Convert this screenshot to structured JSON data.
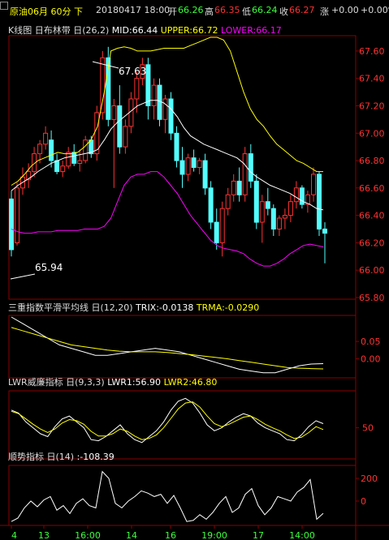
{
  "window": {
    "title": "原油06月 60分 下"
  },
  "quote": {
    "date_time": "20180417 18:00",
    "open_label": "开",
    "open": "66.26",
    "high_label": "高",
    "high": "66.35",
    "low_label": "低",
    "low": "66.24",
    "close_label": "收",
    "close": "66.27",
    "change_label": "涨",
    "change": "+0.00",
    "change_pct": "+0.00%"
  },
  "kline_panel": {
    "name": "K线图",
    "toggle": "日",
    "indicator": "布林带",
    "params": "(26,2)",
    "mid_label": "MID:66.44",
    "upper_label": "UPPER:66.72",
    "lower_label": "LOWER:66.17",
    "high_marker": "67.63",
    "low_marker": "65.94",
    "y_ticks": [
      "67.60",
      "67.40",
      "67.20",
      "67.00",
      "66.80",
      "66.60",
      "66.40",
      "66.20",
      "66.00",
      "65.80"
    ]
  },
  "trix_panel": {
    "name": "三重指数平滑平均线",
    "toggle": "日",
    "params": "(12,20)",
    "trix_label": "TRIX:-0.0138",
    "trma_label": "TRMA:-0.0290",
    "y_ticks": [
      "0.05",
      "0.00"
    ]
  },
  "lwr_panel": {
    "name": "LWR威廉指标",
    "toggle": "日",
    "params": "(9,3,3)",
    "lwr1_label": "LWR1:56.90",
    "lwr2_label": "LWR2:46.80",
    "y_ticks": [
      "50"
    ]
  },
  "cci_panel": {
    "name": "顺势指标",
    "toggle": "日",
    "params": "(14)",
    "value_label": ":-108.39",
    "y_ticks": [
      "200",
      "0"
    ]
  },
  "x_axis": {
    "labels": [
      "4",
      "13",
      "16:00",
      "14",
      "16",
      "19:00",
      "17",
      "14:00"
    ]
  },
  "colors": {
    "up": "#ff3232",
    "down": "#54ffff",
    "upper": "#ffff00",
    "mid": "#ffffff",
    "lower": "#ff00ff",
    "grid": "#8b0000",
    "axis_text": "#ff3232"
  },
  "chart_data": [
    {
      "type": "candlestick",
      "title": "原油06月 60分",
      "series": [
        {
          "name": "K",
          "values": [
            [
              66.52,
              66.58,
              66.1,
              66.15
            ],
            [
              66.2,
              66.64,
              66.18,
              66.6
            ],
            [
              66.6,
              66.75,
              66.55,
              66.68
            ],
            [
              66.66,
              66.78,
              66.6,
              66.72
            ],
            [
              66.72,
              66.9,
              66.68,
              66.85
            ],
            [
              66.85,
              66.95,
              66.78,
              66.92
            ],
            [
              66.92,
              67.05,
              66.88,
              67.0
            ],
            [
              66.95,
              67.02,
              66.75,
              66.8
            ],
            [
              66.8,
              66.85,
              66.7,
              66.72
            ],
            [
              66.72,
              66.8,
              66.68,
              66.76
            ],
            [
              66.76,
              66.9,
              66.74,
              66.86
            ],
            [
              66.86,
              66.92,
              66.76,
              66.78
            ],
            [
              66.78,
              66.88,
              66.72,
              66.8
            ],
            [
              66.8,
              66.98,
              66.78,
              66.95
            ],
            [
              66.95,
              66.98,
              66.82,
              66.85
            ],
            [
              66.85,
              67.2,
              66.8,
              67.15
            ],
            [
              67.15,
              67.6,
              67.1,
              67.55
            ],
            [
              67.55,
              67.63,
              67.05,
              67.1
            ],
            [
              67.1,
              67.25,
              66.6,
              67.2
            ],
            [
              67.2,
              67.35,
              66.85,
              66.9
            ],
            [
              66.9,
              67.1,
              66.85,
              67.05
            ],
            [
              67.05,
              67.3,
              67.0,
              67.25
            ],
            [
              67.25,
              67.45,
              67.15,
              67.4
            ],
            [
              67.4,
              67.55,
              67.35,
              67.5
            ],
            [
              67.5,
              67.55,
              67.1,
              67.2
            ],
            [
              67.2,
              67.4,
              67.1,
              67.35
            ],
            [
              67.35,
              67.4,
              67.05,
              67.1
            ],
            [
              67.1,
              67.28,
              67.0,
              67.25
            ],
            [
              67.25,
              67.3,
              66.95,
              67.0
            ],
            [
              67.0,
              67.05,
              66.75,
              66.8
            ],
            [
              66.8,
              66.9,
              66.6,
              66.7
            ],
            [
              66.7,
              66.85,
              66.65,
              66.82
            ],
            [
              66.82,
              66.88,
              66.72,
              66.75
            ],
            [
              66.75,
              66.82,
              66.7,
              66.8
            ],
            [
              66.8,
              66.85,
              66.55,
              66.6
            ],
            [
              66.6,
              66.65,
              66.3,
              66.35
            ],
            [
              66.35,
              66.45,
              66.15,
              66.2
            ],
            [
              66.2,
              66.5,
              66.1,
              66.45
            ],
            [
              66.45,
              66.6,
              66.4,
              66.55
            ],
            [
              66.55,
              66.7,
              66.5,
              66.65
            ],
            [
              66.65,
              66.75,
              66.5,
              66.55
            ],
            [
              66.55,
              66.9,
              66.5,
              66.85
            ],
            [
              66.85,
              66.92,
              66.6,
              66.65
            ],
            [
              66.65,
              66.7,
              66.3,
              66.35
            ],
            [
              66.35,
              66.55,
              66.2,
              66.5
            ],
            [
              66.5,
              66.6,
              66.4,
              66.45
            ],
            [
              66.45,
              66.48,
              66.25,
              66.3
            ],
            [
              66.3,
              66.4,
              66.25,
              66.38
            ],
            [
              66.38,
              66.45,
              66.3,
              66.4
            ],
            [
              66.4,
              66.55,
              66.35,
              66.5
            ],
            [
              66.5,
              66.65,
              66.45,
              66.6
            ],
            [
              66.6,
              66.62,
              66.45,
              66.48
            ],
            [
              66.48,
              66.58,
              66.42,
              66.55
            ],
            [
              66.55,
              66.75,
              66.5,
              66.7
            ],
            [
              66.7,
              66.72,
              66.25,
              66.3
            ],
            [
              66.3,
              66.35,
              66.05,
              66.27
            ]
          ]
        },
        {
          "name": "UPPER",
          "values": [
            66.62,
            66.65,
            66.7,
            66.76,
            66.8,
            66.82,
            66.84,
            66.86,
            66.85,
            66.85,
            66.86,
            66.9,
            66.95,
            67.05,
            67.3,
            67.6,
            67.62,
            67.63,
            67.62,
            67.6,
            67.6,
            67.6,
            67.61,
            67.62,
            67.62,
            67.62,
            67.62,
            67.64,
            67.66,
            67.68,
            67.7,
            67.7,
            67.68,
            67.6,
            67.45,
            67.3,
            67.18,
            67.1,
            67.05,
            66.98,
            66.92,
            66.88,
            66.84,
            66.8,
            66.78,
            66.75,
            66.72,
            66.72
          ]
        },
        {
          "name": "MID",
          "values": [
            66.58,
            66.62,
            66.65,
            66.68,
            66.72,
            66.75,
            66.78,
            66.8,
            66.82,
            66.83,
            66.84,
            66.85,
            66.86,
            66.88,
            66.95,
            67.03,
            67.08,
            67.12,
            67.16,
            67.2,
            67.22,
            67.24,
            67.24,
            67.22,
            67.18,
            67.12,
            67.04,
            66.98,
            66.95,
            66.92,
            66.9,
            66.88,
            66.86,
            66.84,
            66.82,
            66.78,
            66.72,
            66.68,
            66.65,
            66.62,
            66.6,
            66.58,
            66.56,
            66.53,
            66.5,
            66.48,
            66.45,
            66.44
          ]
        },
        {
          "name": "LOWER",
          "values": [
            66.3,
            66.28,
            66.27,
            66.27,
            66.28,
            66.28,
            66.28,
            66.29,
            66.29,
            66.29,
            66.29,
            66.3,
            66.3,
            66.3,
            66.32,
            66.38,
            66.5,
            66.62,
            66.68,
            66.7,
            66.7,
            66.72,
            66.72,
            66.68,
            66.62,
            66.56,
            66.48,
            66.4,
            66.34,
            66.28,
            66.22,
            66.18,
            66.16,
            66.15,
            66.14,
            66.12,
            66.08,
            66.05,
            66.03,
            66.03,
            66.05,
            66.08,
            66.12,
            66.15,
            66.18,
            66.19,
            66.18,
            66.17
          ]
        }
      ],
      "ylim": [
        65.8,
        67.7
      ]
    },
    {
      "type": "line",
      "title": "三重指数平滑平均线",
      "series": [
        {
          "name": "TRIX",
          "values": [
            0.12,
            0.1,
            0.08,
            0.06,
            0.04,
            0.03,
            0.02,
            0.01,
            0.01,
            0.015,
            0.02,
            0.025,
            0.03,
            0.025,
            0.02,
            0.01,
            0.0,
            -0.01,
            -0.02,
            -0.03,
            -0.035,
            -0.04,
            -0.04,
            -0.03,
            -0.02,
            -0.015,
            -0.014
          ]
        },
        {
          "name": "TRMA",
          "values": [
            0.09,
            0.08,
            0.07,
            0.06,
            0.05,
            0.04,
            0.035,
            0.03,
            0.025,
            0.022,
            0.02,
            0.02,
            0.02,
            0.018,
            0.015,
            0.012,
            0.008,
            0.004,
            0.0,
            -0.005,
            -0.01,
            -0.015,
            -0.02,
            -0.025,
            -0.027,
            -0.028,
            -0.029
          ]
        }
      ],
      "ylim": [
        -0.05,
        0.12
      ]
    },
    {
      "type": "line",
      "title": "LWR威廉指标",
      "series": [
        {
          "name": "LWR1",
          "values": [
            80,
            75,
            60,
            50,
            40,
            35,
            52,
            65,
            70,
            60,
            50,
            30,
            28,
            35,
            45,
            55,
            40,
            30,
            25,
            35,
            45,
            60,
            80,
            95,
            100,
            92,
            75,
            55,
            45,
            50,
            60,
            68,
            74,
            70,
            58,
            50,
            45,
            40,
            30,
            28,
            38,
            52,
            62,
            57
          ]
        },
        {
          "name": "LWR2",
          "values": [
            78,
            74,
            65,
            56,
            48,
            42,
            48,
            58,
            64,
            62,
            56,
            44,
            36,
            36,
            40,
            48,
            44,
            36,
            30,
            32,
            38,
            50,
            66,
            82,
            92,
            94,
            85,
            70,
            57,
            52,
            56,
            62,
            68,
            70,
            64,
            56,
            50,
            45,
            38,
            32,
            34,
            42,
            52,
            47
          ]
        }
      ],
      "ylim": [
        0,
        110
      ]
    },
    {
      "type": "line",
      "title": "顺势指标",
      "series": [
        {
          "name": "CCI",
          "values": [
            -180,
            -150,
            -60,
            0,
            -50,
            10,
            40,
            -80,
            -40,
            -110,
            -20,
            20,
            -40,
            -60,
            260,
            200,
            -20,
            -60,
            0,
            40,
            90,
            70,
            40,
            60,
            -20,
            50,
            -60,
            -180,
            -170,
            -120,
            -160,
            -100,
            -20,
            40,
            -100,
            -60,
            60,
            110,
            -40,
            -120,
            -60,
            40,
            20,
            0,
            80,
            120,
            190,
            -160,
            -108
          ]
        }
      ],
      "ylim": [
        -200,
        300
      ]
    }
  ]
}
